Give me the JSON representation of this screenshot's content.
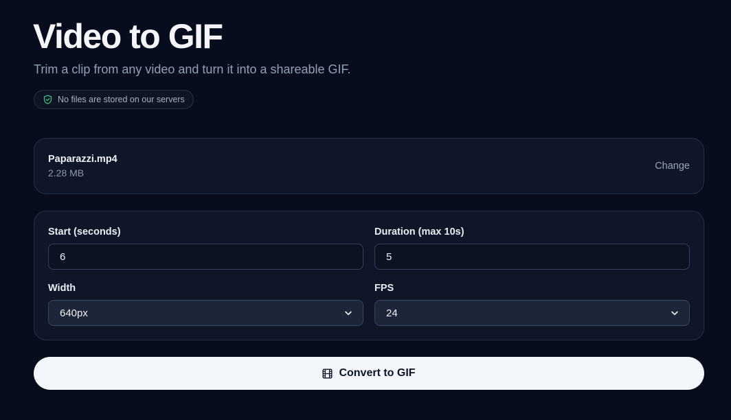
{
  "header": {
    "title": "Video to GIF",
    "subtitle": "Trim a clip from any video and turn it into a shareable GIF.",
    "privacy_badge": "No files are stored on our servers"
  },
  "file": {
    "name": "Paparazzi.mp4",
    "size": "2.28 MB",
    "change_label": "Change"
  },
  "settings": {
    "start": {
      "label": "Start (seconds)",
      "value": "6"
    },
    "duration": {
      "label": "Duration (max 10s)",
      "value": "5"
    },
    "width": {
      "label": "Width",
      "value": "640px"
    },
    "fps": {
      "label": "FPS",
      "value": "24"
    }
  },
  "actions": {
    "convert_label": "Convert to GIF"
  },
  "icons": {
    "badge": "shield-check-icon",
    "select": "chevron-down-icon",
    "convert": "film-icon"
  },
  "colors": {
    "background": "#070d1c",
    "card": "#0e1628",
    "shield": "#3fbf7f",
    "button": "#f3f6fa"
  }
}
